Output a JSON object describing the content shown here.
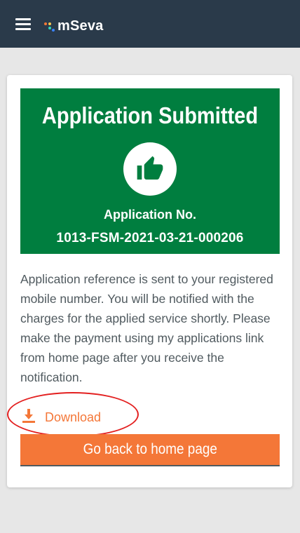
{
  "header": {
    "app_name": "mSeva",
    "menu_icon": "hamburger-menu-icon",
    "background": "#2a3a4a"
  },
  "card": {
    "banner": {
      "title": "Application Submitted",
      "icon": "thumbs-up-icon",
      "app_no_label": "Application No.",
      "app_no_value": "1013-FSM-2021-03-21-000206",
      "background": "#007e3f"
    },
    "message": "Application reference is sent to your registered mobile number. You will be notified with the charges for the applied service shortly. Please make the payment using my applications link from home page after you receive the notification.",
    "download": {
      "label": "Download",
      "icon": "download-icon"
    },
    "home_button": {
      "label": "Go back to home page"
    }
  },
  "colors": {
    "accent": "#f47738",
    "success": "#007e3f",
    "highlight_annotation": "#e32020",
    "text": "#505a5f"
  }
}
